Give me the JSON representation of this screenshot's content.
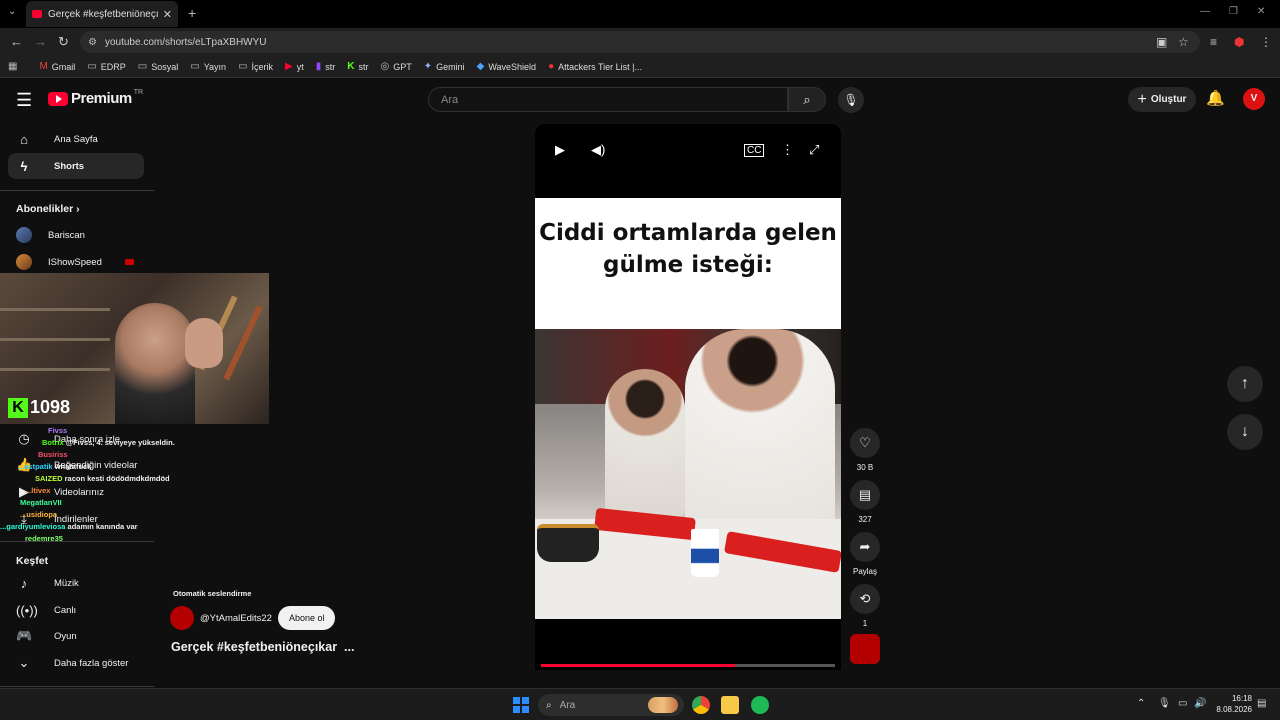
{
  "browser": {
    "tab_title": "Gerçek #keşfetbeniöneçıkar #",
    "url": "youtube.com/shorts/eLTpaXBHWYU",
    "bookmarks": [
      {
        "label": "Gmail",
        "icon": "gmail-icon"
      },
      {
        "label": "EDRP",
        "icon": "folder-icon"
      },
      {
        "label": "Sosyal",
        "icon": "folder-icon"
      },
      {
        "label": "Yayın",
        "icon": "folder-icon"
      },
      {
        "label": "İçerik",
        "icon": "folder-icon"
      },
      {
        "label": "yt",
        "icon": "youtube-icon"
      },
      {
        "label": "str",
        "icon": "twitch-icon"
      },
      {
        "label": "str",
        "icon": "kick-icon"
      },
      {
        "label": "GPT",
        "icon": "chatgpt-icon"
      },
      {
        "label": "Gemini",
        "icon": "gemini-icon"
      },
      {
        "label": "WaveShield",
        "icon": "waveshield-icon"
      },
      {
        "label": "Attackers Tier List |...",
        "icon": "attackers-icon"
      }
    ]
  },
  "header": {
    "logo_text": "Premium",
    "logo_region": "TR",
    "search_placeholder": "Ara",
    "create_label": "Oluştur",
    "avatar_text": "V"
  },
  "sidebar": {
    "home": "Ana Sayfa",
    "shorts": "Shorts",
    "subscriptions_title": "Abonelikler",
    "subs": [
      "Bariscan",
      "IShowSpeed"
    ],
    "watch_later": "Daha sonra izle",
    "liked": "Beğendiğin videolar",
    "your_videos": "Videolarınız",
    "downloads": "İndirilenler",
    "explore_title": "Keşfet",
    "music": "Müzik",
    "live": "Canlı",
    "gaming": "Oyun",
    "show_more": "Daha fazla göster"
  },
  "overlay": {
    "viewer_count": "1098",
    "chat": [
      {
        "user": "Fivss",
        "msg": "",
        "color": "#b07cff"
      },
      {
        "user": "Botrix",
        "msg": "@Fivss, 4. seviyeye yükseldin.",
        "color": "#53fc18"
      },
      {
        "user": "Busiriss",
        "msg": "",
        "color": "#ff4d6a"
      },
      {
        "user": "...astpatik",
        "msg": "whatafuck",
        "color": "#2ad4ff"
      },
      {
        "user": "SAIZED",
        "msg": "racon kesti dödödmdkdmdöd",
        "color": "#b9ff3a"
      },
      {
        "user": "...ltivex",
        "msg": "",
        "color": "#ff8a3d"
      },
      {
        "user": "MegatlanVII",
        "msg": "",
        "color": "#3dff9b"
      },
      {
        "user": "...usidiopa",
        "msg": "",
        "color": "#ffb43d"
      },
      {
        "user": "...gardiyumleviosa",
        "msg": "adamın kanında var",
        "color": "#2affd4"
      },
      {
        "user": "redemre35",
        "msg": "",
        "color": "#7dff6a"
      }
    ]
  },
  "short": {
    "caption": "Ciddi ortamlarda gelen gülme isteği:",
    "auto_dub": "Otomatik seslendirme",
    "channel": "@YtAmalEdits22",
    "subscribe": "Abone ol",
    "title": "Gerçek #keşfetbeniöneçıkar",
    "title_more": "...",
    "likes": "30 B",
    "comments": "327",
    "share": "Paylaş",
    "remix": "1",
    "progress": 0.66
  },
  "taskbar": {
    "search_placeholder": "Ara",
    "time": "16:18",
    "date": "8.08.2026"
  }
}
